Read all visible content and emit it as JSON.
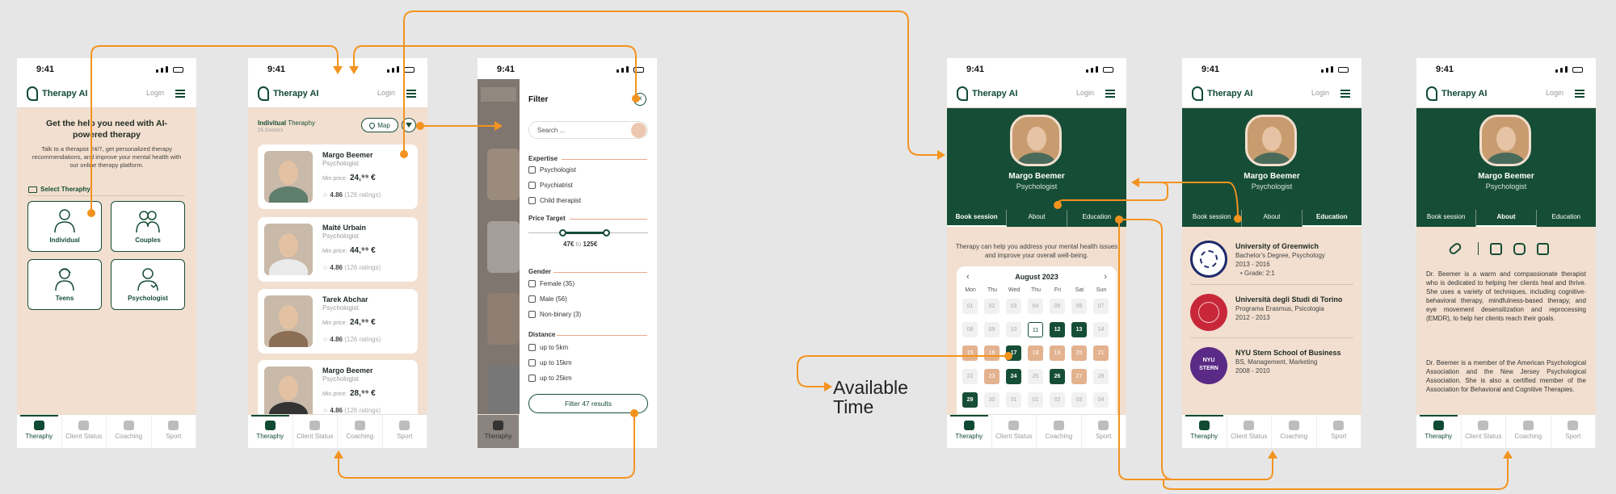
{
  "status_time": "9:41",
  "app_name": "Therapy AI",
  "login_label": "Login",
  "tabs": [
    "Theraphy",
    "Client Status",
    "Coaching",
    "Sport"
  ],
  "home": {
    "headline": "Get the help you need with AI-powered therapy",
    "intro": "Talk to a therapist 24/7, get personalized therapy recommendations, and improve your mental health with our online therapy platform.",
    "select_label": "Select Theraphy",
    "categories": [
      "Individual",
      "Couples",
      "Teens",
      "Psychologist"
    ]
  },
  "list": {
    "title_bold": "Indivitual",
    "title_rest": " Theraphy",
    "subtitle": "25 Doctors",
    "map_label": "Map",
    "min_price_label": "Min price:",
    "therapists": [
      {
        "name": "Margo Beemer",
        "role": "Psychologist",
        "price": "24,⁹⁹ €",
        "rating": "4.86",
        "ratings_count": "(126 ratings)"
      },
      {
        "name": "Maîté Urbain",
        "role": "Psychologist",
        "price": "44,⁹⁹ €",
        "rating": "4.86",
        "ratings_count": "(126 ratings)"
      },
      {
        "name": "Tarek Abchar",
        "role": "Psychologist",
        "price": "24,⁹⁹ €",
        "rating": "4.86",
        "ratings_count": "(126 ratings)"
      },
      {
        "name": "Margo Beemer",
        "role": "Psychologist",
        "price": "28,⁹⁹ €",
        "rating": "4.86",
        "ratings_count": "(126 ratings)"
      }
    ]
  },
  "filter": {
    "title": "Filter",
    "search_placeholder": "Search ...",
    "expertise_label": "Expertise",
    "expertise": [
      "Psychologist",
      "Psychiatrist",
      "Child therapist"
    ],
    "price_label": "Price Target",
    "price_min": "47€",
    "price_to": "to",
    "price_max": "125€",
    "gender_label": "Gender",
    "gender": [
      "Female (35)",
      "Male (56)",
      "Non-binary (3)"
    ],
    "distance_label": "Distance",
    "distance": [
      "up to 5km",
      "up to 15km",
      "up to 25km"
    ],
    "apply_label": "Filter 47 results"
  },
  "profile": {
    "name": "Margo Beemer",
    "role": "Psychologist",
    "tabs": [
      "Book session",
      "About",
      "Education"
    ],
    "book_intro": "Therapy can help you address your mental health issues and improve your overall well-being.",
    "calendar": {
      "month": "August 2023",
      "dow": [
        "Mon",
        "Thu",
        "Wed",
        "Thu",
        "Fri",
        "Sat",
        "Sun"
      ],
      "days": [
        "01",
        "02",
        "03",
        "04",
        "05",
        "06",
        "07",
        "08",
        "09",
        "10",
        "11",
        "12",
        "13",
        "14",
        "15",
        "16",
        "17",
        "18",
        "19",
        "20",
        "21",
        "22",
        "23",
        "24",
        "25",
        "26",
        "27",
        "28",
        "29",
        "30",
        "31",
        "01",
        "02",
        "03",
        "04"
      ]
    },
    "education": [
      {
        "school": "University of Greenwich",
        "lines": [
          "Bachelor's Degree, Psychology",
          "2013 - 2016",
          "• Grade: 2:1"
        ]
      },
      {
        "school": "Università degli Studi di Torino",
        "lines": [
          "Programa Erasmus, Psicologia",
          "2012 - 2013"
        ]
      },
      {
        "school": "NYU Stern School of Business",
        "lines": [
          "BS, Management, Marketing",
          "2008 - 2010"
        ],
        "seal_text": [
          "NYU",
          "STERN"
        ]
      }
    ],
    "about": [
      "Dr. Beemer is a warm and compassionate therapist who is dedicated to helping her clients heal and thrive. She uses a variety of techniques, including cognitive-behavioral therapy, mindfulness-based therapy, and eye movement desensitization and reprocessing (EMDR), to help her clients reach their goals.",
      "Dr. Beemer is a member of the American Psychological Association and the New Jersey Psychological Association. She is also a certified member of the Association for Behavioral and Cognitive Therapies."
    ]
  },
  "annotation": [
    "Available",
    "Time"
  ],
  "colors": {
    "brand": "#164d36",
    "background": "#f2dfcf",
    "accent": "#f3931f",
    "booked": "#e3b28f"
  }
}
